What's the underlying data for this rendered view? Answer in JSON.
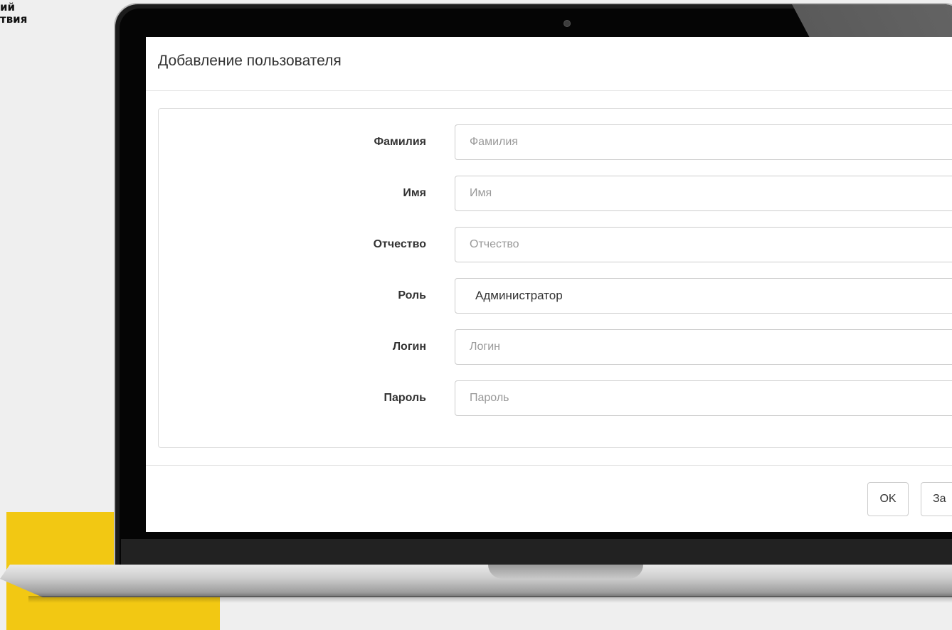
{
  "corner": {
    "line1": "ий",
    "line2": "твия"
  },
  "modal": {
    "title": "Добавление пользователя",
    "fields": [
      {
        "label": "Фамилия",
        "placeholder": "Фамилия",
        "value": ""
      },
      {
        "label": "Имя",
        "placeholder": "Имя",
        "value": ""
      },
      {
        "label": "Отчество",
        "placeholder": "Отчество",
        "value": ""
      },
      {
        "label": "Роль",
        "value": "Администратор"
      },
      {
        "label": "Логин",
        "placeholder": "Логин",
        "value": ""
      },
      {
        "label": "Пароль",
        "placeholder": "Пароль",
        "value": ""
      }
    ],
    "buttons": {
      "ok": "OK",
      "close": "За"
    }
  },
  "colors": {
    "accent_yellow": "#f2c813",
    "background": "#efefef",
    "border": "#cccccc"
  }
}
